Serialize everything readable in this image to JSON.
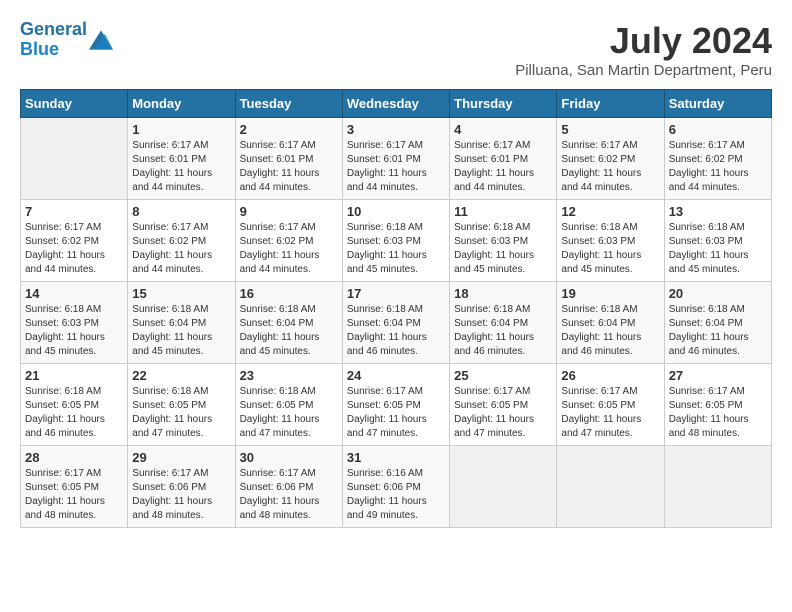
{
  "header": {
    "logo_line1": "General",
    "logo_line2": "Blue",
    "title": "July 2024",
    "subtitle": "Pilluana, San Martin Department, Peru"
  },
  "days_of_week": [
    "Sunday",
    "Monday",
    "Tuesday",
    "Wednesday",
    "Thursday",
    "Friday",
    "Saturday"
  ],
  "weeks": [
    [
      {
        "num": "",
        "detail": ""
      },
      {
        "num": "1",
        "detail": "Sunrise: 6:17 AM\nSunset: 6:01 PM\nDaylight: 11 hours\nand 44 minutes."
      },
      {
        "num": "2",
        "detail": "Sunrise: 6:17 AM\nSunset: 6:01 PM\nDaylight: 11 hours\nand 44 minutes."
      },
      {
        "num": "3",
        "detail": "Sunrise: 6:17 AM\nSunset: 6:01 PM\nDaylight: 11 hours\nand 44 minutes."
      },
      {
        "num": "4",
        "detail": "Sunrise: 6:17 AM\nSunset: 6:01 PM\nDaylight: 11 hours\nand 44 minutes."
      },
      {
        "num": "5",
        "detail": "Sunrise: 6:17 AM\nSunset: 6:02 PM\nDaylight: 11 hours\nand 44 minutes."
      },
      {
        "num": "6",
        "detail": "Sunrise: 6:17 AM\nSunset: 6:02 PM\nDaylight: 11 hours\nand 44 minutes."
      }
    ],
    [
      {
        "num": "7",
        "detail": "Sunrise: 6:17 AM\nSunset: 6:02 PM\nDaylight: 11 hours\nand 44 minutes."
      },
      {
        "num": "8",
        "detail": "Sunrise: 6:17 AM\nSunset: 6:02 PM\nDaylight: 11 hours\nand 44 minutes."
      },
      {
        "num": "9",
        "detail": "Sunrise: 6:17 AM\nSunset: 6:02 PM\nDaylight: 11 hours\nand 44 minutes."
      },
      {
        "num": "10",
        "detail": "Sunrise: 6:18 AM\nSunset: 6:03 PM\nDaylight: 11 hours\nand 45 minutes."
      },
      {
        "num": "11",
        "detail": "Sunrise: 6:18 AM\nSunset: 6:03 PM\nDaylight: 11 hours\nand 45 minutes."
      },
      {
        "num": "12",
        "detail": "Sunrise: 6:18 AM\nSunset: 6:03 PM\nDaylight: 11 hours\nand 45 minutes."
      },
      {
        "num": "13",
        "detail": "Sunrise: 6:18 AM\nSunset: 6:03 PM\nDaylight: 11 hours\nand 45 minutes."
      }
    ],
    [
      {
        "num": "14",
        "detail": "Sunrise: 6:18 AM\nSunset: 6:03 PM\nDaylight: 11 hours\nand 45 minutes."
      },
      {
        "num": "15",
        "detail": "Sunrise: 6:18 AM\nSunset: 6:04 PM\nDaylight: 11 hours\nand 45 minutes."
      },
      {
        "num": "16",
        "detail": "Sunrise: 6:18 AM\nSunset: 6:04 PM\nDaylight: 11 hours\nand 45 minutes."
      },
      {
        "num": "17",
        "detail": "Sunrise: 6:18 AM\nSunset: 6:04 PM\nDaylight: 11 hours\nand 46 minutes."
      },
      {
        "num": "18",
        "detail": "Sunrise: 6:18 AM\nSunset: 6:04 PM\nDaylight: 11 hours\nand 46 minutes."
      },
      {
        "num": "19",
        "detail": "Sunrise: 6:18 AM\nSunset: 6:04 PM\nDaylight: 11 hours\nand 46 minutes."
      },
      {
        "num": "20",
        "detail": "Sunrise: 6:18 AM\nSunset: 6:04 PM\nDaylight: 11 hours\nand 46 minutes."
      }
    ],
    [
      {
        "num": "21",
        "detail": "Sunrise: 6:18 AM\nSunset: 6:05 PM\nDaylight: 11 hours\nand 46 minutes."
      },
      {
        "num": "22",
        "detail": "Sunrise: 6:18 AM\nSunset: 6:05 PM\nDaylight: 11 hours\nand 47 minutes."
      },
      {
        "num": "23",
        "detail": "Sunrise: 6:18 AM\nSunset: 6:05 PM\nDaylight: 11 hours\nand 47 minutes."
      },
      {
        "num": "24",
        "detail": "Sunrise: 6:17 AM\nSunset: 6:05 PM\nDaylight: 11 hours\nand 47 minutes."
      },
      {
        "num": "25",
        "detail": "Sunrise: 6:17 AM\nSunset: 6:05 PM\nDaylight: 11 hours\nand 47 minutes."
      },
      {
        "num": "26",
        "detail": "Sunrise: 6:17 AM\nSunset: 6:05 PM\nDaylight: 11 hours\nand 47 minutes."
      },
      {
        "num": "27",
        "detail": "Sunrise: 6:17 AM\nSunset: 6:05 PM\nDaylight: 11 hours\nand 48 minutes."
      }
    ],
    [
      {
        "num": "28",
        "detail": "Sunrise: 6:17 AM\nSunset: 6:05 PM\nDaylight: 11 hours\nand 48 minutes."
      },
      {
        "num": "29",
        "detail": "Sunrise: 6:17 AM\nSunset: 6:06 PM\nDaylight: 11 hours\nand 48 minutes."
      },
      {
        "num": "30",
        "detail": "Sunrise: 6:17 AM\nSunset: 6:06 PM\nDaylight: 11 hours\nand 48 minutes."
      },
      {
        "num": "31",
        "detail": "Sunrise: 6:16 AM\nSunset: 6:06 PM\nDaylight: 11 hours\nand 49 minutes."
      },
      {
        "num": "",
        "detail": ""
      },
      {
        "num": "",
        "detail": ""
      },
      {
        "num": "",
        "detail": ""
      }
    ]
  ]
}
